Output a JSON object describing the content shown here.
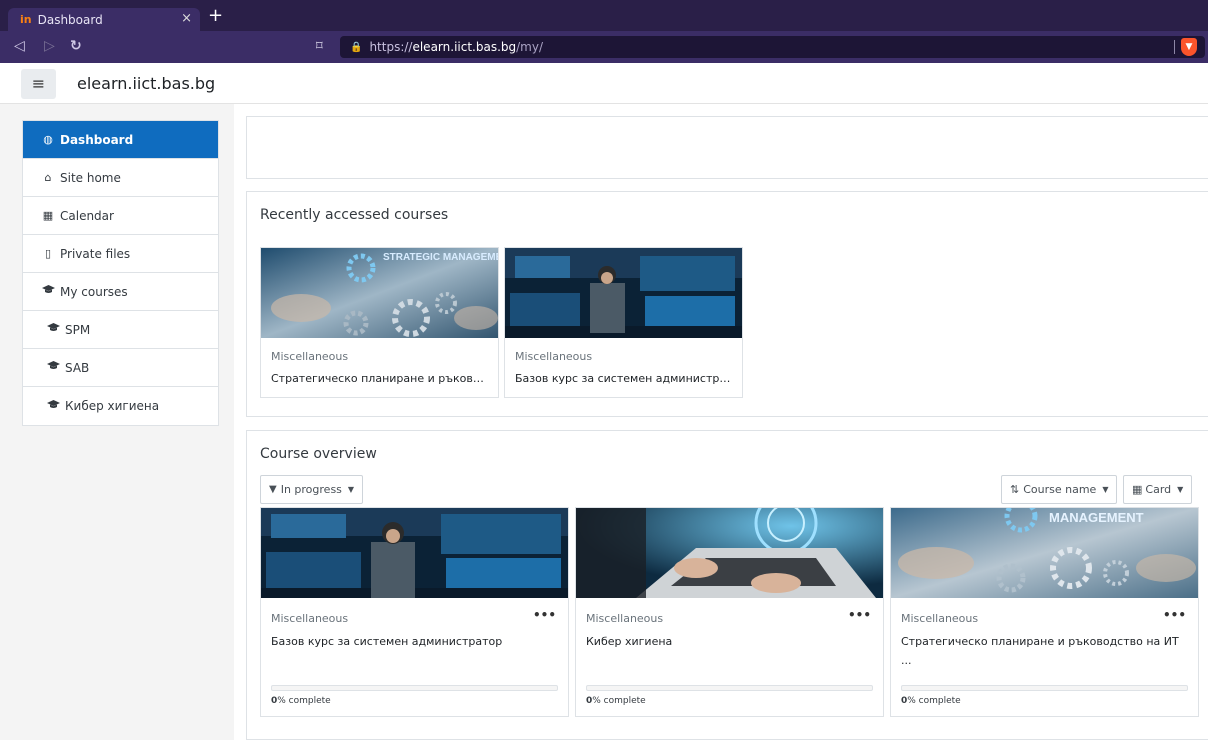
{
  "browser": {
    "tab_title": "Dashboard",
    "tab_close": "×",
    "new_tab": "+",
    "favicon": "in",
    "url_scheme": "https://",
    "url_host": "elearn.iict.bas.bg",
    "url_path": "/my/",
    "icons": [
      "back-icon",
      "forward-icon",
      "reload-icon",
      "bookmark-icon",
      "lock-icon",
      "brave-shield-icon"
    ]
  },
  "header": {
    "site_name": "elearn.iict.bas.bg",
    "menu_icon": "≡"
  },
  "sidebar": {
    "items": [
      {
        "label": "Dashboard",
        "icon": "tachometer-icon",
        "glyph": "◍",
        "active": true
      },
      {
        "label": "Site home",
        "icon": "home-icon",
        "glyph": "⌂"
      },
      {
        "label": "Calendar",
        "icon": "calendar-icon",
        "glyph": "▦"
      },
      {
        "label": "Private files",
        "icon": "file-icon",
        "glyph": "▯"
      },
      {
        "label": "My courses",
        "icon": "graduation-cap-icon",
        "glyph": "🎓"
      },
      {
        "label": "SPM",
        "icon": "graduation-cap-icon",
        "glyph": "🎓"
      },
      {
        "label": "SAB",
        "icon": "graduation-cap-icon",
        "glyph": "🎓"
      },
      {
        "label": "Кибер хигиена",
        "icon": "graduation-cap-icon",
        "glyph": "🎓"
      }
    ]
  },
  "recent": {
    "title": "Recently accessed courses",
    "courses": [
      {
        "category": "Miscellaneous",
        "name": "Стратегическо планиране и ръководст...",
        "image_text": "STRATEGIC MANAGEMENT"
      },
      {
        "category": "Miscellaneous",
        "name": "Базов курс за системен администратор"
      }
    ]
  },
  "overview": {
    "title": "Course overview",
    "filter_label": "In progress",
    "sort_label": "Course name",
    "view_label": "Card",
    "courses": [
      {
        "category": "Miscellaneous",
        "name": "Базов курс за системен администратор",
        "progress": 0,
        "progress_value": "0",
        "progress_suffix": "% complete",
        "menu": "•••"
      },
      {
        "category": "Miscellaneous",
        "name": "Кибер хигиена",
        "progress": 0,
        "progress_value": "0",
        "progress_suffix": "% complete",
        "menu": "•••"
      },
      {
        "category": "Miscellaneous",
        "name": "Стратегическо планиране и ръководство на ИТ ...",
        "progress": 0,
        "progress_value": "0",
        "progress_suffix": "% complete",
        "menu": "•••",
        "image_text": "MANAGEMENT"
      }
    ]
  },
  "colors": {
    "accent": "#0f6cbf",
    "browser_bg": "#2a1f48"
  }
}
